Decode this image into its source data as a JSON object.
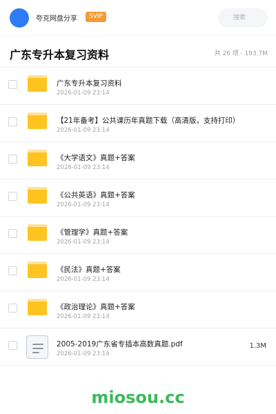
{
  "header": {
    "username": "夸克网盘分享",
    "badge": "SVIP",
    "search_placeholder": "搜索"
  },
  "folder": {
    "title": "广东专升本复习资料",
    "summary": "共 26 项 · 193.7M"
  },
  "items": [
    {
      "name": "广东专升本复习资料",
      "date": "2026-01-09 23:14",
      "type": "folder",
      "size": ""
    },
    {
      "name": "【21年备考】公共课历年真题下载（高清版，支持打印）",
      "date": "2026-01-09 23:14",
      "type": "folder",
      "size": ""
    },
    {
      "name": "《大学语文》真题+答案",
      "date": "2026-01-09 23:14",
      "type": "folder",
      "size": ""
    },
    {
      "name": "《公共英语》真题+答案",
      "date": "2026-01-09 23:14",
      "type": "folder",
      "size": ""
    },
    {
      "name": "《管理学》真题+答案",
      "date": "2026-01-09 23:14",
      "type": "folder",
      "size": ""
    },
    {
      "name": "《民法》真题+答案",
      "date": "2026-01-09 23:14",
      "type": "folder",
      "size": ""
    },
    {
      "name": "《政治理论》真题+答案",
      "date": "2026-01-09 23:14",
      "type": "folder",
      "size": ""
    },
    {
      "name": "2005-2019广东省专插本高数真题.pdf",
      "date": "2026-01-09 23:14",
      "type": "document",
      "size": "1.3M"
    }
  ],
  "watermark": "miosou.cc",
  "colors": {
    "avatar": "#2f7bf5",
    "svip_badge": "#f29a38",
    "folder_icon": "#ffc41f",
    "watermark": "#3cb95a"
  }
}
